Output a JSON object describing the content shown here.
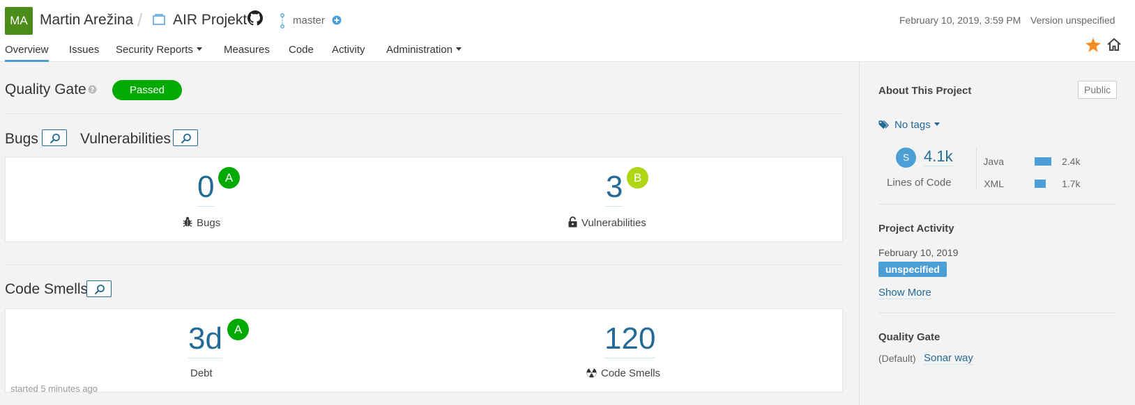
{
  "header": {
    "avatar_initials": "MA",
    "organization": "Martin Arežina",
    "project": "AIR Projekt",
    "branch": "master",
    "analysis_date": "February 10, 2019, 3:59 PM",
    "version": "Version unspecified"
  },
  "nav": {
    "items": [
      {
        "label": "Overview",
        "active": true
      },
      {
        "label": "Issues"
      },
      {
        "label": "Security Reports",
        "dropdown": true
      },
      {
        "label": "Measures"
      },
      {
        "label": "Code"
      },
      {
        "label": "Activity"
      },
      {
        "label": "Administration",
        "dropdown": true
      }
    ]
  },
  "quality_gate": {
    "title": "Quality Gate",
    "status": "Passed",
    "status_color": "#00aa00"
  },
  "reliability": {
    "bugs_title": "Bugs",
    "vulnerabilities_title": "Vulnerabilities",
    "bugs_value": "0",
    "bugs_rating": "A",
    "bugs_label": "Bugs",
    "vulnerabilities_value": "3",
    "vulnerabilities_rating": "B",
    "vulnerabilities_label": "Vulnerabilities"
  },
  "maintainability": {
    "title": "Code Smells",
    "debt_value": "3d",
    "debt_rating": "A",
    "debt_label": "Debt",
    "smells_value": "120",
    "smells_label": "Code Smells",
    "started": "started 5 minutes ago"
  },
  "sidebar": {
    "about_title": "About This Project",
    "visibility": "Public",
    "tags": "No tags",
    "loc_size_letter": "S",
    "loc_value": "4.1k",
    "loc_label": "Lines of Code",
    "languages": [
      {
        "name": "Java",
        "value": "2.4k",
        "share": 0.59
      },
      {
        "name": "XML",
        "value": "1.7k",
        "share": 0.41
      }
    ],
    "activity_title": "Project Activity",
    "activity_date": "February 10, 2019",
    "activity_version": "unspecified",
    "show_more": "Show More",
    "qg_title": "Quality Gate",
    "qg_default": "(Default)",
    "qg_name": "Sonar way"
  },
  "colors": {
    "accent": "#4b9fd5",
    "link": "#236a97",
    "rating_a": "#00aa00",
    "rating_b": "#b0d513",
    "star": "#f28c23"
  }
}
